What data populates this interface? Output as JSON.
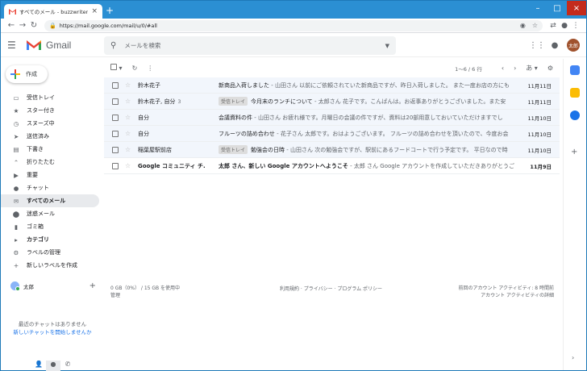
{
  "browser": {
    "tab_title": "すべてのメール - buzzwriter.zz@gm",
    "url": "https://mail.google.com/mail/u/0/#all"
  },
  "header": {
    "app_name": "Gmail",
    "search_placeholder": "メールを検索",
    "avatar_text": "太郎"
  },
  "compose": {
    "label": "作成"
  },
  "sidebar": {
    "items": [
      {
        "label": "受信トレイ",
        "icon": "inbox-icon"
      },
      {
        "label": "スター付き",
        "icon": "star-icon"
      },
      {
        "label": "スヌーズ中",
        "icon": "clock-icon"
      },
      {
        "label": "送信済み",
        "icon": "send-icon"
      },
      {
        "label": "下書き",
        "icon": "draft-icon"
      },
      {
        "label": "折りたたむ",
        "icon": "chevron-up-icon"
      },
      {
        "label": "重要",
        "icon": "important-icon"
      },
      {
        "label": "チャット",
        "icon": "chat-icon"
      },
      {
        "label": "すべてのメール",
        "icon": "mail-icon"
      },
      {
        "label": "迷惑メール",
        "icon": "spam-icon"
      },
      {
        "label": "ゴミ箱",
        "icon": "trash-icon"
      },
      {
        "label": "カテゴリ",
        "icon": "label-icon"
      },
      {
        "label": "ラベルの管理",
        "icon": "gear-icon"
      },
      {
        "label": "新しいラベルを作成",
        "icon": "plus-icon"
      }
    ]
  },
  "chat": {
    "user": "太郎",
    "no_chat": "最近のチャットはありません",
    "start_link": "新しいチャットを開始しませんか"
  },
  "toolbar": {
    "range": "1～6 / 6 行",
    "lang": "あ"
  },
  "emails": [
    {
      "sender": "鈴木花子",
      "count": "",
      "label": "",
      "subject": "新商品入荷しました",
      "snippet": " - 山田さん 以前にご依頼されていた新商品ですが、昨日入荷しました。 また一度お店の方にも",
      "date": "11月11日"
    },
    {
      "sender": "鈴木花子, 自分",
      "count": "3",
      "label": "受信トレイ",
      "subject": "今月末のランチについて",
      "snippet": " - 太郎さん 花子です。こんばんは。お返事ありがとうございました。また安",
      "date": "11月11日"
    },
    {
      "sender": "自分",
      "count": "",
      "label": "",
      "subject": "会議資料の件",
      "snippet": " - 山田さん お疲れ様です。月曜日の会議の件ですが、資料は20部用意しておいていただけますでし",
      "date": "11月10日"
    },
    {
      "sender": "自分",
      "count": "",
      "label": "",
      "subject": "フルーツの詰め合わせ",
      "snippet": " - 花子さん 太郎です。おはようございます。 フルーツの詰め合わせを頂いたので、今度お会",
      "date": "11月10日"
    },
    {
      "sender": "稲葉屋駅前店",
      "count": "",
      "label": "受信トレイ",
      "subject": "勉強会の日時",
      "snippet": " - 山田さん 次の勉強会ですが、駅前にあるフードコートで行う予定です。 平日なので時",
      "date": "11月10日"
    },
    {
      "sender": "Google コミュニティ チ.",
      "count": "",
      "label": "",
      "subject": "太郎 さん、新しい Google アカウントへようこそ",
      "snippet": " - 太郎 さん Google アカウントを作成していただきありがとうご",
      "date": "11月9日",
      "unread": true
    }
  ],
  "footer": {
    "storage": "0 GB（0%） / 15 GB を使用中",
    "manage": "管理",
    "terms": "利用規約 · プライバシー · プログラム ポリシー",
    "activity": "前回のアカウント アクティビティ: 8 時間前",
    "details": "アカウント アクティビティの詳細"
  },
  "colors": {
    "accent": "#1a73e8",
    "red": "#ea4335",
    "yellow": "#fbbc04",
    "green": "#34a853"
  }
}
